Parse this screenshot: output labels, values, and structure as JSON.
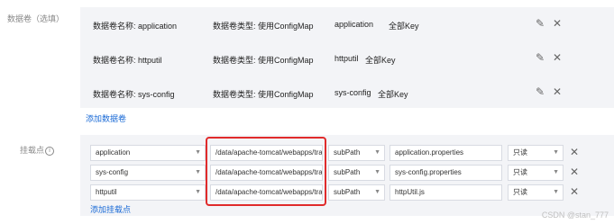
{
  "volumes": {
    "label": "数据卷（选填）",
    "rows": [
      {
        "name": "数据卷名称: application",
        "type": "数据卷类型: 使用ConfigMap",
        "config": "application",
        "keys": "全部Key"
      },
      {
        "name": "数据卷名称: httputil",
        "type": "数据卷类型: 使用ConfigMap",
        "config": "httputil",
        "keys": "全部Key"
      },
      {
        "name": "数据卷名称: sys-config",
        "type": "数据卷类型: 使用ConfigMap",
        "config": "sys-config",
        "keys": "全部Key"
      }
    ],
    "add_link": "添加数据卷",
    "edit_icon": "pencil-icon",
    "delete_icon": "close-icon"
  },
  "mounts": {
    "label": "挂载点",
    "info_glyph": "i",
    "rows": [
      {
        "volume": "application",
        "path": "/data/apache-tomcat/webapps/tra",
        "mode": "subPath",
        "subpath": "application.properties",
        "access": "只读"
      },
      {
        "volume": "sys-config",
        "path": "/data/apache-tomcat/webapps/tra",
        "mode": "subPath",
        "subpath": "sys-config.properties",
        "access": "只读"
      },
      {
        "volume": "httputil",
        "path": "/data/apache-tomcat/webapps/tra",
        "mode": "subPath",
        "subpath": "httpUtil.js",
        "access": "只读"
      }
    ],
    "add_link": "添加挂载点"
  },
  "caret_glyph": "▼",
  "close_glyph": "✕",
  "pencil_glyph": "✎",
  "watermark": "CSDN @stan_777",
  "colors": {
    "accent": "#1a6ad6",
    "highlight": "#e02b2b",
    "panel": "#f3f4f7"
  }
}
